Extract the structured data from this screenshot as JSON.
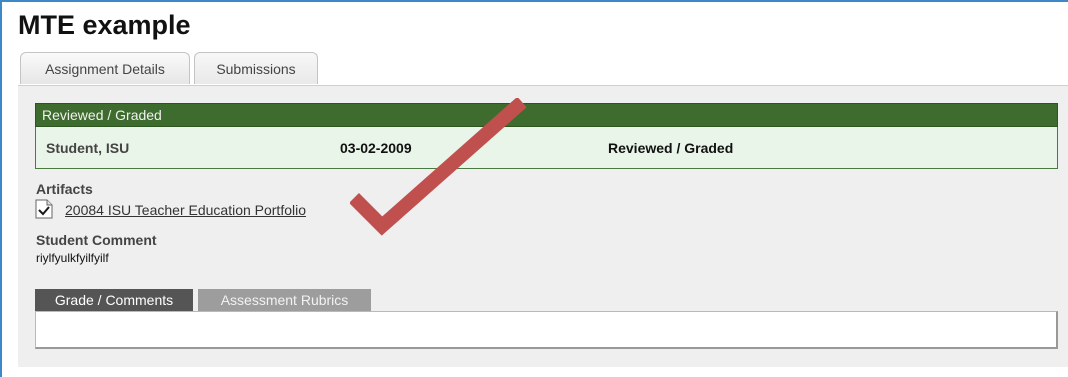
{
  "page": {
    "title": "MTE example"
  },
  "tabs": [
    {
      "label": "Assignment Details"
    },
    {
      "label": "Submissions"
    }
  ],
  "status": {
    "header": "Reviewed / Graded",
    "student": "Student, ISU",
    "date": "03-02-2009",
    "state": "Reviewed / Graded"
  },
  "artifacts": {
    "label": "Artifacts",
    "items": [
      {
        "name": "20084 ISU Teacher Education Portfolio",
        "icon": "document-icon"
      }
    ]
  },
  "student_comment": {
    "label": "Student Comment",
    "text": "riylfyulkfyilfyilf"
  },
  "subtabs": [
    {
      "label": "Grade / Comments"
    },
    {
      "label": "Assessment Rubrics"
    }
  ],
  "colors": {
    "status_bar": "#3e6b2e",
    "status_row": "#e9f5e8",
    "checkmark": "#c0504d",
    "frame_border": "#3e88c8"
  }
}
